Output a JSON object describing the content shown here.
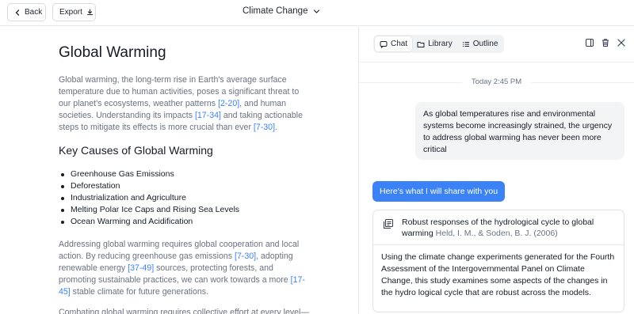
{
  "header": {
    "back_label": "Back",
    "export_label": "Export",
    "doc_title": "Climate Change"
  },
  "document": {
    "title": "Global Warming",
    "para1": [
      {
        "t": "Global warming, the long-term rise in Earth's average surface temperature due to human activities, poses a significant threat to our planet's ecosystems, weather patterns "
      },
      {
        "t": "[2-20]",
        "cite": true
      },
      {
        "t": ", and human societies. Understanding its impacts "
      },
      {
        "t": "[17-34]",
        "cite": true
      },
      {
        "t": " and taking actionable steps to mitigate its effects is more crucial than ever "
      },
      {
        "t": "[7-30]",
        "cite": true
      },
      {
        "t": "."
      }
    ],
    "section_heading": "Key Causes of Global Warming",
    "causes": [
      "Greenhouse Gas Emissions",
      "Deforestation",
      "Industrialization and Agriculture",
      "Melting Polar Ice Caps and Rising Sea Levels",
      "Ocean Warming and Acidification"
    ],
    "para2": [
      {
        "t": "Addressing global warming requires global cooperation and local action. By reducing greenhouse gas emissions "
      },
      {
        "t": "[7-30]",
        "cite": true
      },
      {
        "t": ", adopting renewable energy "
      },
      {
        "t": "[37-49]",
        "cite": true
      },
      {
        "t": " sources, protecting forests, and promoting sustainable practices, we can work towards a more "
      },
      {
        "t": "[17-45]",
        "cite": true
      },
      {
        "t": " stable climate for future generations."
      }
    ],
    "para3": "Combating global warming requires collective effort at every level—"
  },
  "pane": {
    "tabs": [
      {
        "label": "Chat",
        "icon": "chat-icon",
        "active": true
      },
      {
        "label": "Library",
        "icon": "folder-icon",
        "active": false
      },
      {
        "label": "Outline",
        "icon": "list-icon",
        "active": false
      }
    ],
    "timestamp": "Today 2:45 PM",
    "user_message": "As global temperatures rise and environmental systems become increasingly strained, the urgency to address global warming has never been more critical",
    "ai_message": "Here's what I will share with you",
    "source": {
      "title": "Robust responses of the hydrological cycle to global warming",
      "authors": "Held, I. M., & Soden, B. J. (2006)",
      "summary": "Using the climate change experiments generated for the Fourth Assessment of the Intergovernmental Panel on Climate Change, this study examines some aspects of the changes in the hydro logical cycle that are robust across the models."
    }
  },
  "colors": {
    "accent": "#3b82f6",
    "muted_text": "#6b7280"
  }
}
